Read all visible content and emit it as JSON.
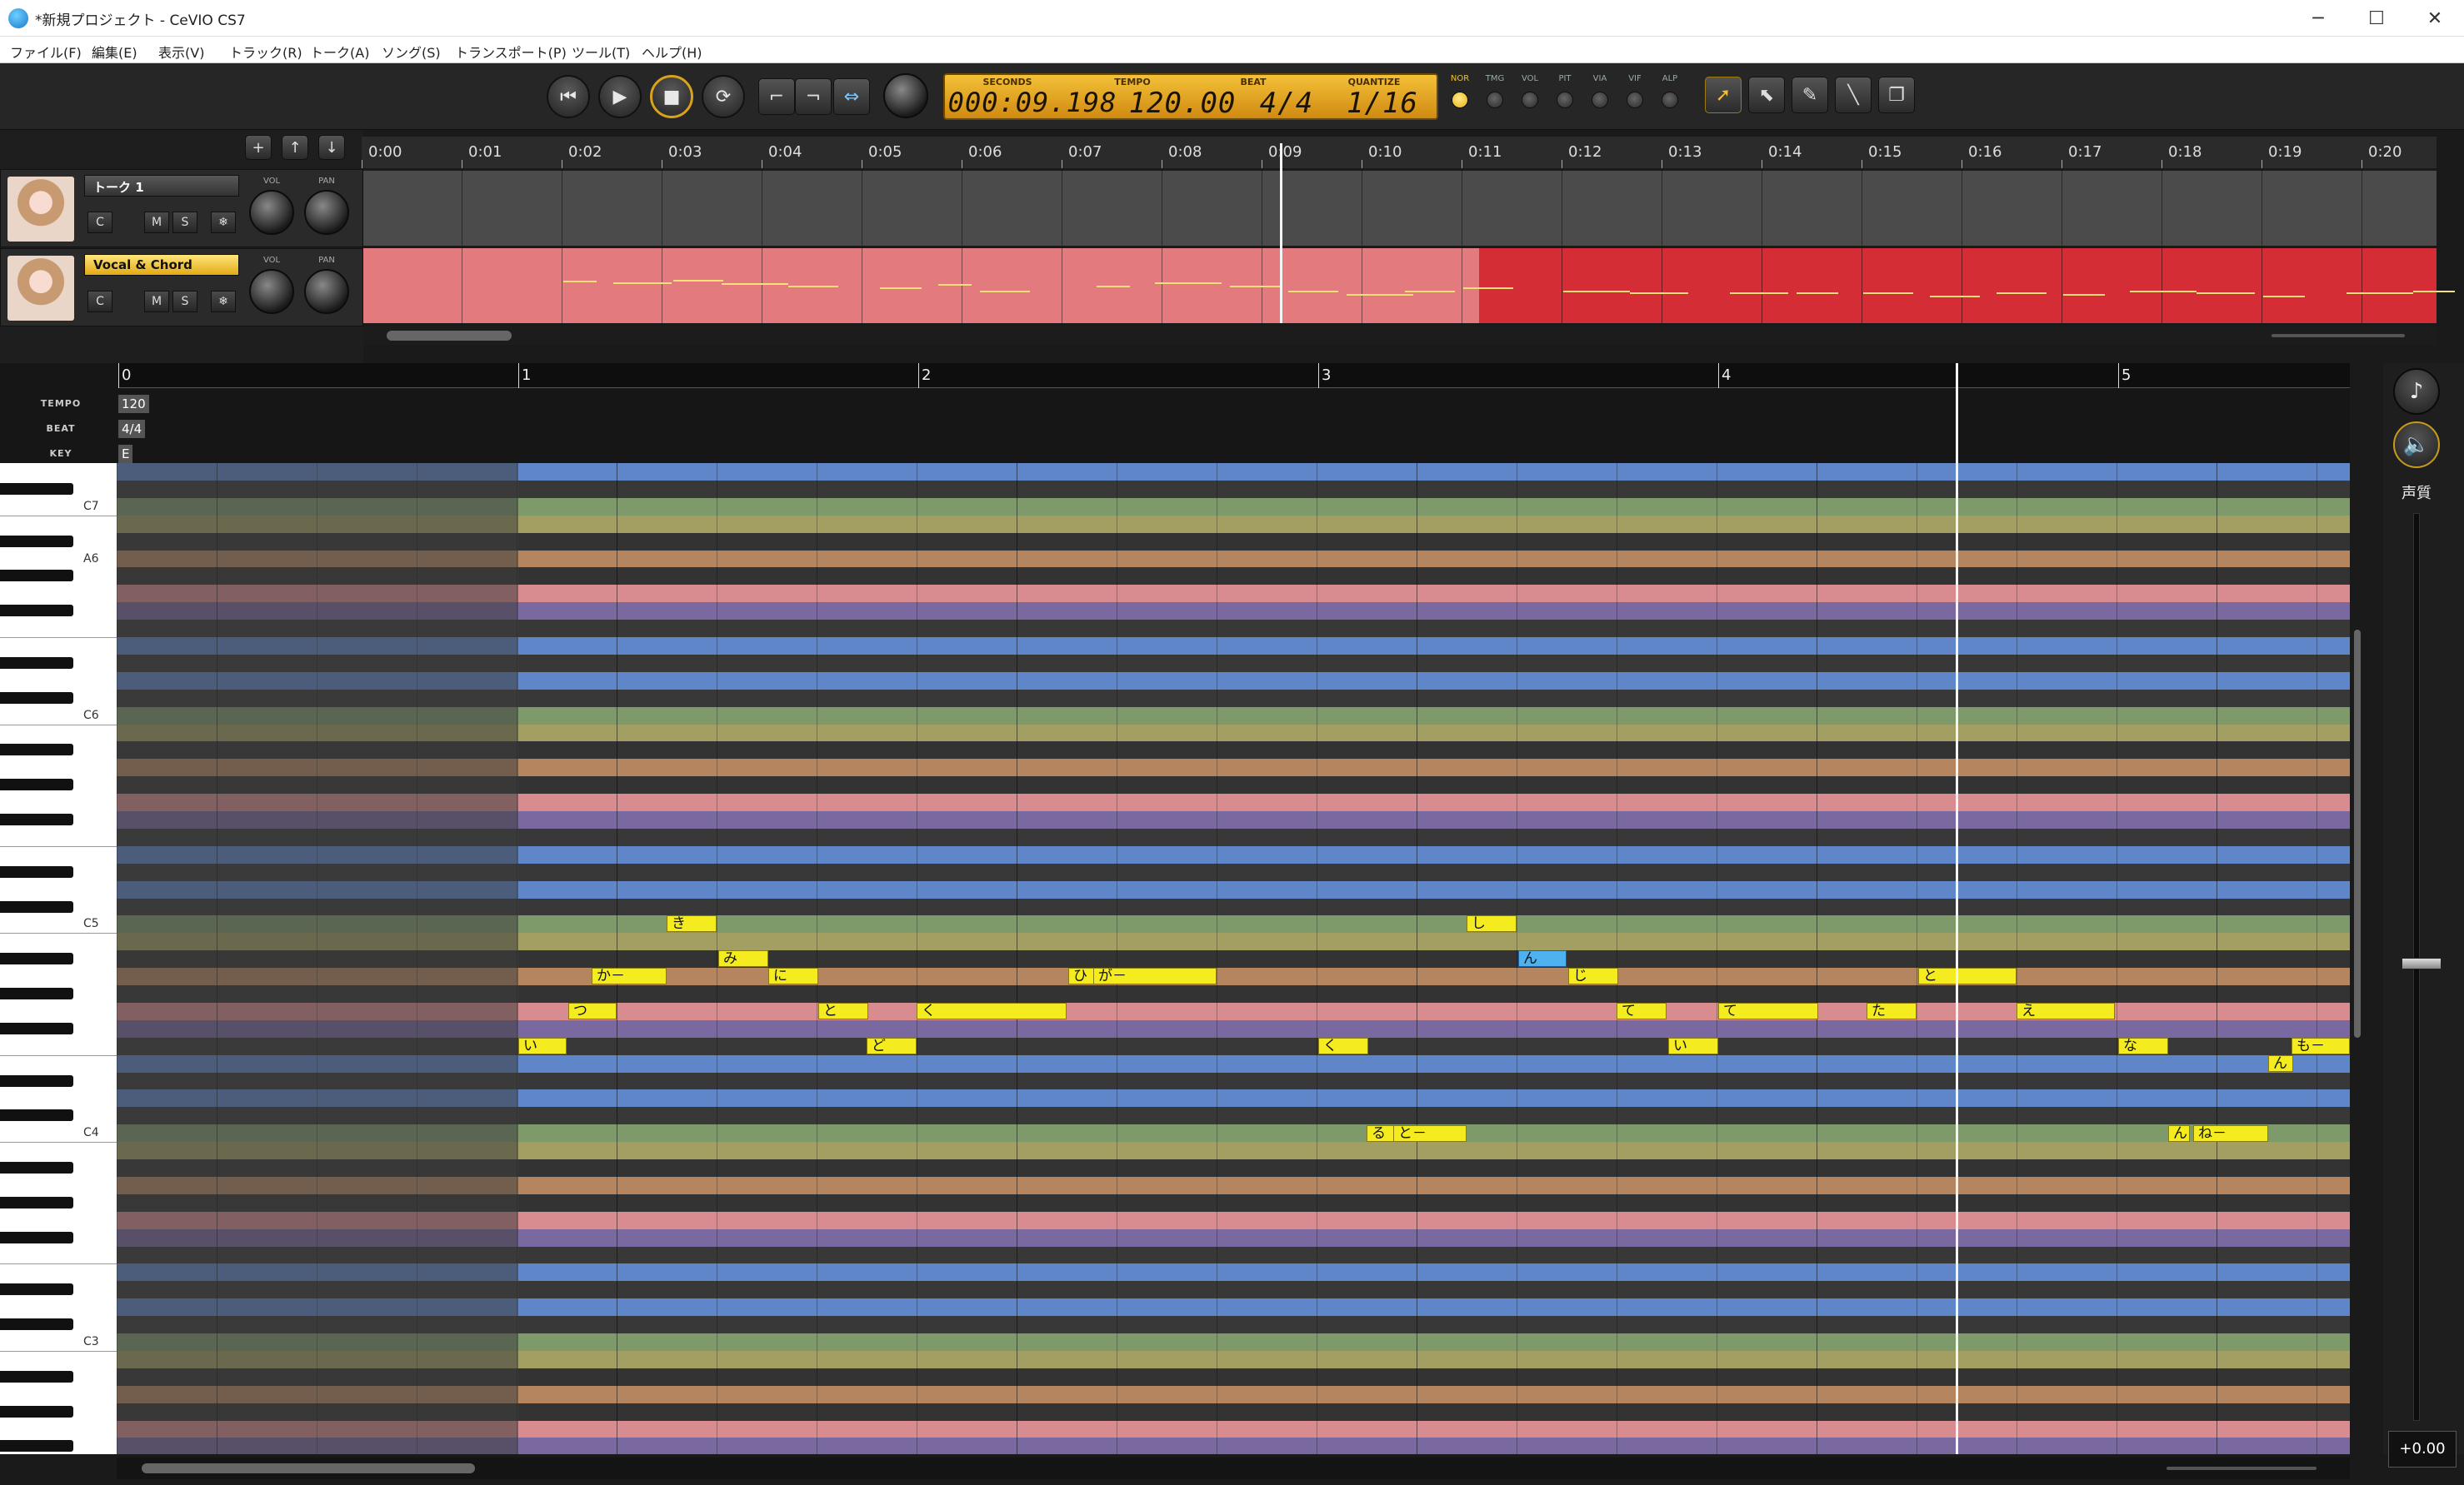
{
  "window": {
    "title": "*新規プロジェクト - CeVIO CS7",
    "minimize": "─",
    "maximize": "☐",
    "close": "✕"
  },
  "menu": [
    "ファイル(F)",
    "編集(E)",
    "表示(V)",
    "トラック(R)",
    "トーク(A)",
    "ソング(S)",
    "トランスポート(P)",
    "ツール(T)",
    "ヘルプ(H)"
  ],
  "transport": {
    "buttons": [
      "⏮",
      "▶",
      "■",
      "⟳"
    ],
    "lcd": {
      "labels": [
        "SECONDS",
        "TEMPO",
        "BEAT",
        "QUANTIZE"
      ],
      "seconds": "000:09.198",
      "tempo": "120.00",
      "beat": "4/4",
      "quantize": "1/16"
    },
    "modes": [
      "NOR",
      "TMG",
      "VOL",
      "PIT",
      "VIA",
      "VIF",
      "ALP"
    ]
  },
  "track_controls": {
    "add": "+",
    "up": "↑",
    "down": "↓"
  },
  "timeline": [
    "0:00",
    "0:01",
    "0:02",
    "0:03",
    "0:04",
    "0:05",
    "0:06",
    "0:07",
    "0:08",
    "0:09",
    "0:10",
    "0:11",
    "0:12",
    "0:13",
    "0:14",
    "0:15",
    "0:16",
    "0:17",
    "0:18",
    "0:19",
    "0:20"
  ],
  "tracks": [
    {
      "name": "トーク 1",
      "vol": "VOL",
      "pan": "PAN",
      "c": "C",
      "m": "M",
      "s": "S",
      "fx": "❄"
    },
    {
      "name": "Vocal & Chord",
      "vol": "VOL",
      "pan": "PAN",
      "c": "C",
      "m": "M",
      "s": "S",
      "fx": "❄"
    }
  ],
  "roll": {
    "measures": [
      "0",
      "1",
      "2",
      "3",
      "4",
      "5"
    ],
    "tempo_label": "TEMPO",
    "tempo": "120",
    "beat_label": "BEAT",
    "beat": "4/4",
    "key_label": "KEY",
    "key": "E"
  },
  "keys": [
    "C7",
    "A6",
    "C6",
    "C5",
    "C4",
    "C3"
  ],
  "notes": [
    "い",
    "つ",
    "か－",
    "き",
    "み",
    "に",
    "と",
    "ど",
    "く",
    "ひ",
    "が－",
    "く",
    "る",
    "と－",
    "し",
    "ん",
    "じ",
    "て",
    "い",
    "て",
    "た",
    "と",
    "え",
    "な",
    "ん",
    "も－",
    "ん",
    "ね－"
  ],
  "right_panel": {
    "label": "声質",
    "value": "+0.00",
    "icon_top": "♪",
    "icon_sound": "🔈"
  },
  "colors": {
    "lane_pink": "#d88c8f",
    "lane_purple": "#7a69a0",
    "lane_blue": "#5f86c9",
    "lane_green": "#7f9a6a",
    "lane_olive": "#a39f63",
    "lane_orange": "#b58560",
    "note": "#f4ec1e",
    "note_selected": "#4fb2f0",
    "accent": "#e3a916"
  }
}
